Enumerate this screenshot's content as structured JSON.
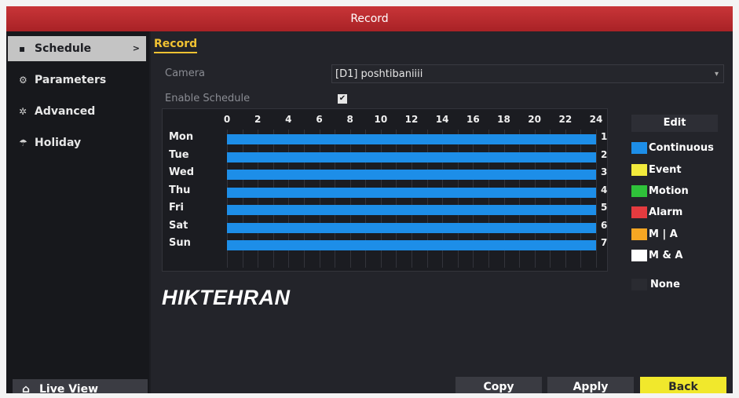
{
  "title": "Record",
  "sidebar": {
    "items": [
      {
        "label": "Schedule",
        "icon": "square-icon",
        "glyph": "▪"
      },
      {
        "label": "Parameters",
        "icon": "gear-icon",
        "glyph": "⚙"
      },
      {
        "label": "Advanced",
        "icon": "gear-wrench-icon",
        "glyph": "✲"
      },
      {
        "label": "Holiday",
        "icon": "umbrella-icon",
        "glyph": "☂"
      }
    ],
    "active_chevron": ">",
    "live_view": {
      "label": "Live View",
      "icon": "home-icon",
      "glyph": "⌂"
    }
  },
  "main": {
    "tab": "Record",
    "camera_label": "Camera",
    "camera_value": "[D1] poshtibaniiii",
    "enable_label": "Enable Schedule",
    "enable_checked": true,
    "check_glyph": "✔",
    "hours": [
      "0",
      "2",
      "4",
      "6",
      "8",
      "10",
      "12",
      "14",
      "16",
      "18",
      "20",
      "22",
      "24"
    ],
    "days": [
      {
        "label": "Mon",
        "num": "1"
      },
      {
        "label": "Tue",
        "num": "2"
      },
      {
        "label": "Wed",
        "num": "3"
      },
      {
        "label": "Thu",
        "num": "4"
      },
      {
        "label": "Fri",
        "num": "5"
      },
      {
        "label": "Sat",
        "num": "6"
      },
      {
        "label": "Sun",
        "num": "7"
      }
    ],
    "schedule_type": "Continuous",
    "schedule_coverage": [
      0,
      24
    ]
  },
  "legend": {
    "edit_label": "Edit",
    "items": [
      {
        "label": "Continuous",
        "color": "#1d8ee8"
      },
      {
        "label": "Event",
        "color": "#f2ea3c"
      },
      {
        "label": "Motion",
        "color": "#2fc23a"
      },
      {
        "label": "Alarm",
        "color": "#e43b3f"
      },
      {
        "label": "M | A",
        "color": "#f5a623"
      },
      {
        "label": "M & A",
        "color": "#ffffff"
      },
      {
        "label": "None",
        "color": "#2a2b31"
      }
    ]
  },
  "watermark": "HIKTEHRAN",
  "buttons": {
    "copy": "Copy",
    "apply": "Apply",
    "back": "Back"
  }
}
